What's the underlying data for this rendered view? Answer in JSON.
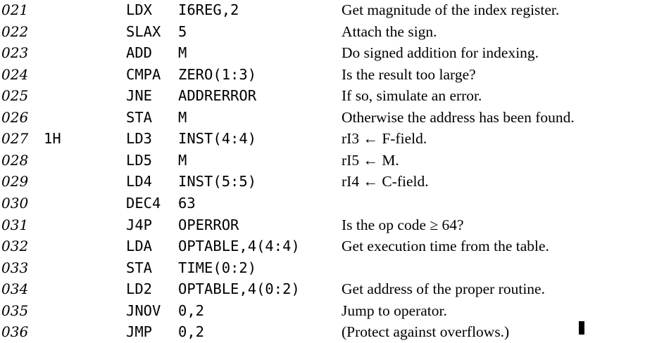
{
  "listing": [
    {
      "line": "021",
      "label": "",
      "op": "LDX",
      "addr": "I6REG,2",
      "remark": "Get magnitude of the index register."
    },
    {
      "line": "022",
      "label": "",
      "op": "SLAX",
      "addr": "5",
      "remark": "Attach the sign."
    },
    {
      "line": "023",
      "label": "",
      "op": "ADD",
      "addr": "M",
      "remark": "Do signed addition for indexing."
    },
    {
      "line": "024",
      "label": "",
      "op": "CMPA",
      "addr": "ZERO(1:3)",
      "remark": "Is the result too large?"
    },
    {
      "line": "025",
      "label": "",
      "op": "JNE",
      "addr": "ADDRERROR",
      "remark": "If so, simulate an error."
    },
    {
      "line": "026",
      "label": "",
      "op": "STA",
      "addr": "M",
      "remark": "Otherwise the address has been found."
    },
    {
      "line": "027",
      "label": "1H",
      "op": "LD3",
      "addr": "INST(4:4)",
      "remark": "rI3 ← F-field."
    },
    {
      "line": "028",
      "label": "",
      "op": "LD5",
      "addr": "M",
      "remark": "rI5 ← M."
    },
    {
      "line": "029",
      "label": "",
      "op": "LD4",
      "addr": "INST(5:5)",
      "remark": "rI4 ← C-field."
    },
    {
      "line": "030",
      "label": "",
      "op": "DEC4",
      "addr": "63",
      "remark": ""
    },
    {
      "line": "031",
      "label": "",
      "op": "J4P",
      "addr": "OPERROR",
      "remark": "Is the op code ≥ 64?"
    },
    {
      "line": "032",
      "label": "",
      "op": "LDA",
      "addr": "OPTABLE,4(4:4)",
      "remark": "Get execution time from the table."
    },
    {
      "line": "033",
      "label": "",
      "op": "STA",
      "addr": "TIME(0:2)",
      "remark": ""
    },
    {
      "line": "034",
      "label": "",
      "op": "LD2",
      "addr": "OPTABLE,4(0:2)",
      "remark": "Get address of the proper routine."
    },
    {
      "line": "035",
      "label": "",
      "op": "JNOV",
      "addr": "0,2",
      "remark": "Jump to operator."
    },
    {
      "line": "036",
      "label": "",
      "op": "JMP",
      "addr": "0,2",
      "remark": "(Protect against overflows.)"
    }
  ]
}
